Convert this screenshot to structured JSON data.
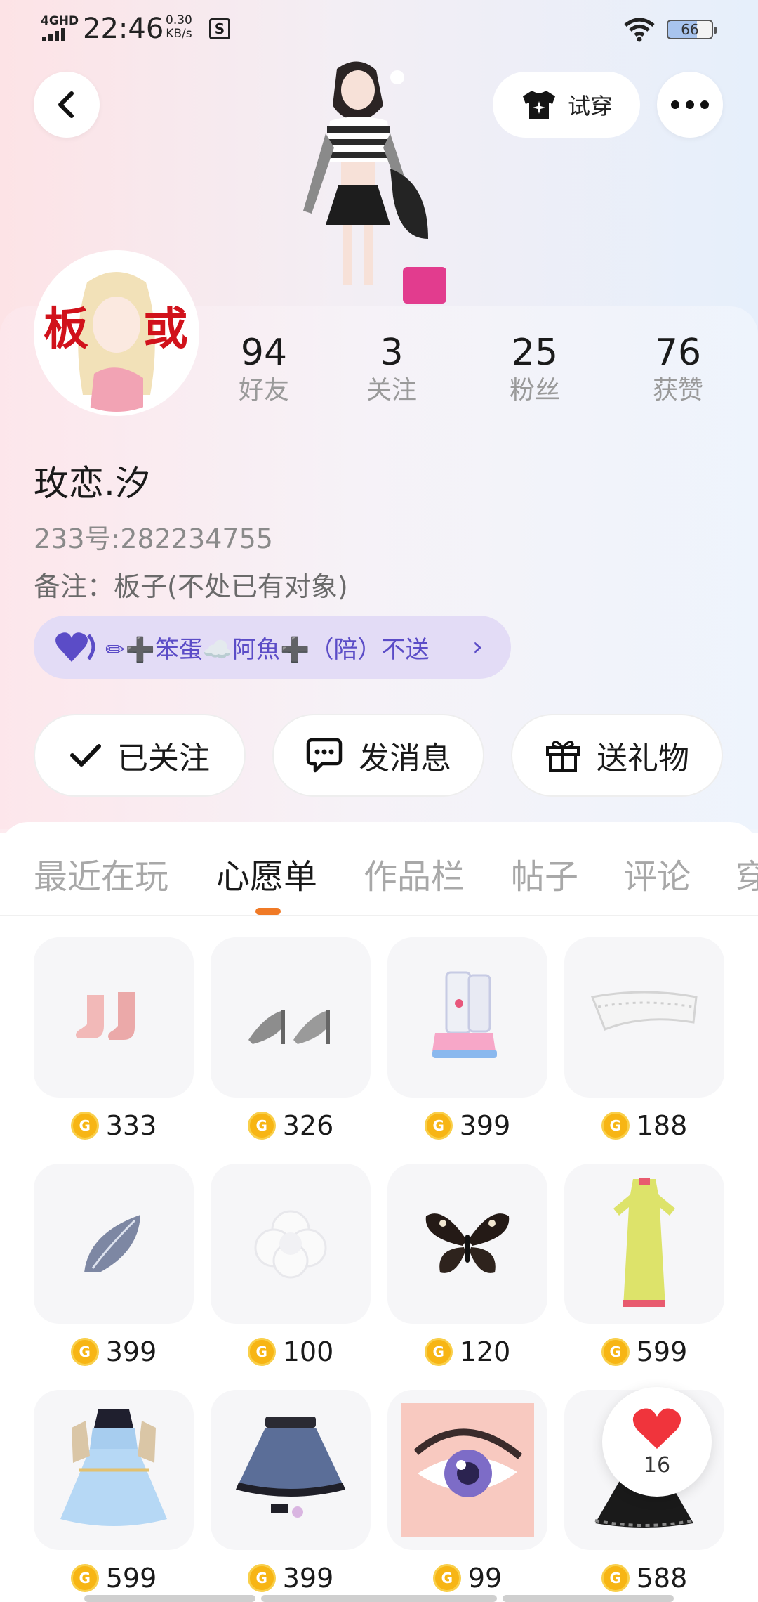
{
  "status_bar": {
    "network": "4GHD",
    "time": "22:46",
    "speed_value": "0.30",
    "speed_unit": "KB/s",
    "battery": "66"
  },
  "header": {
    "try_on_label": "试穿"
  },
  "profile": {
    "stats": [
      {
        "value": "94",
        "label": "好友"
      },
      {
        "value": "3",
        "label": "关注"
      },
      {
        "value": "25",
        "label": "粉丝"
      },
      {
        "value": "76",
        "label": "获赞"
      }
    ],
    "nickname": "玫恋.汐",
    "uid": "233号:282234755",
    "remark": "备注：板子(不处已有对象)",
    "group_text": "✏➕笨蛋☁️阿魚➕（陪）不送",
    "avatar_text": "板 或"
  },
  "actions": {
    "follow_label": "已关注",
    "message_label": "发消息",
    "gift_label": "送礼物"
  },
  "tabs": [
    {
      "label": "最近在玩",
      "active": false
    },
    {
      "label": "心愿单",
      "active": true
    },
    {
      "label": "作品栏",
      "active": false
    },
    {
      "label": "帖子",
      "active": false
    },
    {
      "label": "评论",
      "active": false
    },
    {
      "label": "穿",
      "active": false
    }
  ],
  "wishlist": [
    {
      "price": "333",
      "icon": "socks-icon"
    },
    {
      "price": "326",
      "icon": "heels-icon"
    },
    {
      "price": "399",
      "icon": "boots-icon"
    },
    {
      "price": "188",
      "icon": "headband-icon"
    },
    {
      "price": "399",
      "icon": "feather-icon"
    },
    {
      "price": "100",
      "icon": "flower-icon"
    },
    {
      "price": "120",
      "icon": "butterfly-icon"
    },
    {
      "price": "599",
      "icon": "qipao-dress-icon"
    },
    {
      "price": "599",
      "icon": "blue-dress-icon"
    },
    {
      "price": "399",
      "icon": "denim-skirt-icon"
    },
    {
      "price": "99",
      "icon": "eye-icon"
    },
    {
      "price": "588",
      "icon": "black-skirt-icon"
    }
  ],
  "like": {
    "count": "16"
  },
  "colors": {
    "accent": "#f07a26",
    "group_pill_bg": "#e3dcf6",
    "group_text": "#5b4cc7",
    "coin": "#f7b514",
    "like_heart": "#f0343c"
  }
}
